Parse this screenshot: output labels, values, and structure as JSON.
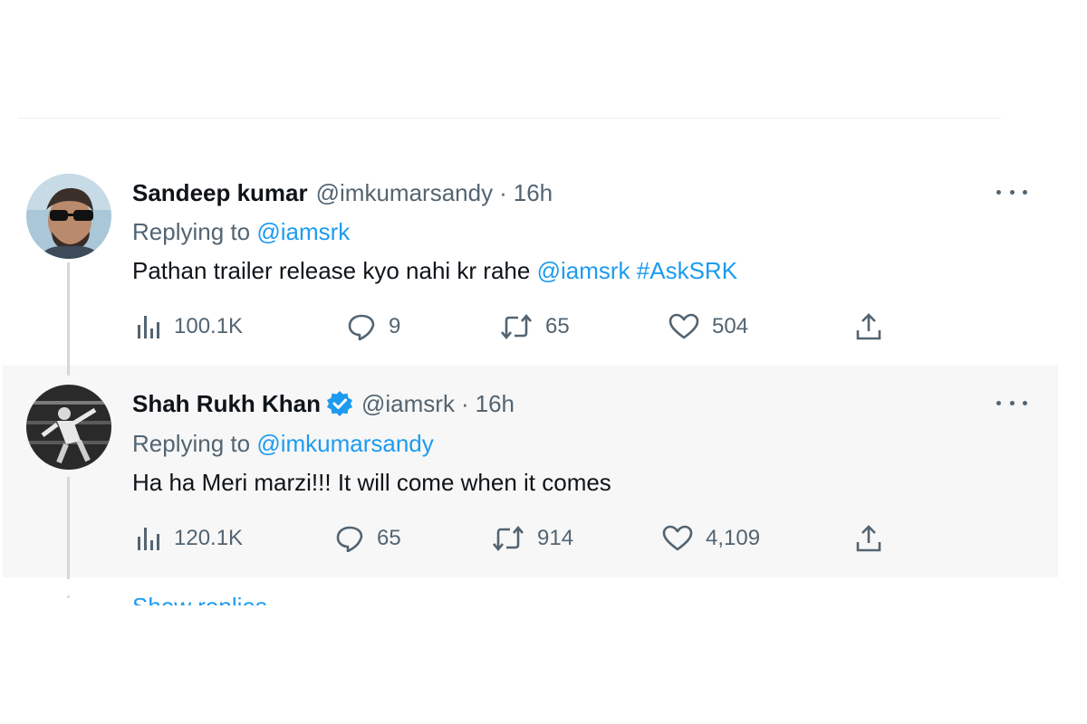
{
  "tweets": [
    {
      "name": "Sandeep kumar",
      "handle": "@imkumarsandy",
      "separator": "·",
      "time": "16h",
      "replying_prefix": "Replying to",
      "replying_to": "@iamsrk",
      "text_plain": "Pathan trailer release kyo nahi kr rahe",
      "text_mention": "@iamsrk",
      "text_hashtag": "#AskSRK",
      "stats": {
        "views": "100.1K",
        "replies": "9",
        "retweets": "65",
        "likes": "504"
      },
      "verified": false
    },
    {
      "name": "Shah Rukh Khan",
      "handle": "@iamsrk",
      "separator": "·",
      "time": "16h",
      "replying_prefix": "Replying to",
      "replying_to": "@imkumarsandy",
      "text_plain": "Ha ha Meri marzi!!! It will come when it comes",
      "stats": {
        "views": "120.1K",
        "replies": "65",
        "retweets": "914",
        "likes": "4,109"
      },
      "verified": true
    }
  ],
  "show_replies_label": "Show replies",
  "colors": {
    "link": "#1d9bf0",
    "muted": "#536471",
    "text": "#0f1419",
    "highlight_bg": "#f7f7f7",
    "thread_line": "#cfd9de"
  },
  "icons": {
    "views": "bar-chart-icon",
    "replies": "speech-bubble-icon",
    "retweets": "retweet-icon",
    "likes": "heart-icon",
    "share": "share-upload-icon",
    "more": "more-dots-icon",
    "verified": "verified-badge-icon"
  }
}
